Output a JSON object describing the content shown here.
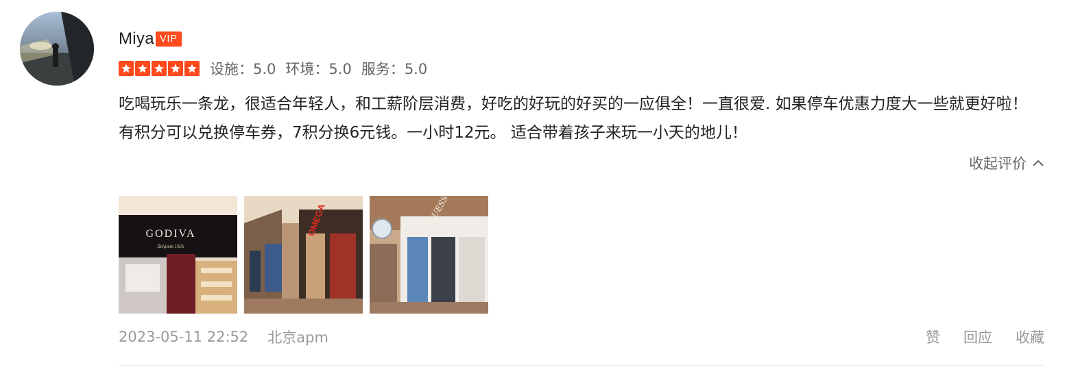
{
  "user": {
    "name": "Miya",
    "badge": "VIP"
  },
  "rating": {
    "stars": 5,
    "max_stars": 5,
    "scores": [
      {
        "label": "设施：",
        "value": "5.0"
      },
      {
        "label": "环境：",
        "value": "5.0"
      },
      {
        "label": "服务：",
        "value": "5.0"
      }
    ]
  },
  "review": {
    "text": "吃喝玩乐一条龙，很适合年轻人，和工薪阶层消费，好吃的好玩的好买的一应俱全！一直很爱. 如果停车优惠力度大一些就更好啦！有积分可以兑换停车券，7积分换6元钱。一小时12元。 适合带着孩子来玩一小天的地儿！",
    "collapse_label": "收起评价"
  },
  "photos": [
    {
      "sign_text": "GODIVA",
      "sub_text": "Belgium 1926"
    },
    {
      "sign_text": "OMEGA"
    },
    {
      "sign_text": "GUESS"
    }
  ],
  "meta": {
    "datetime": "2023-05-11 22:52",
    "location": "北京apm"
  },
  "actions": {
    "like": "赞",
    "reply": "回应",
    "favorite": "收藏"
  },
  "colors": {
    "accent": "#ff4a1d",
    "text_primary": "#222222",
    "text_secondary": "#666666",
    "text_muted": "#999999"
  }
}
